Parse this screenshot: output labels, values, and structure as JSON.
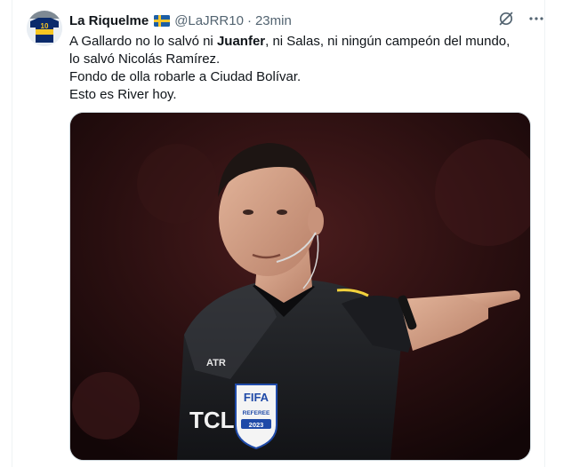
{
  "tweet": {
    "display_name": "La Riquelme",
    "handle": "@LaJRR10",
    "separator": "·",
    "time": "23min",
    "text_line1_before": "A Gallardo no lo salvó ni ",
    "text_line1_bold": "Juanfer",
    "text_line1_after": ", ni Salas, ni ningún campeón del mundo,",
    "text_line2": "lo salvó Nicolás Ramírez.",
    "text_line3": "Fondo de olla robarle a Ciudad Bolívar.",
    "text_line4": "Esto es River hoy."
  },
  "media": {
    "badge_brand": "FIFA",
    "badge_role": "REFEREE",
    "badge_year": "2023",
    "sponsor": "TCL",
    "kit_logo": "ATR"
  },
  "icons": {
    "avatar": "boca-jersey-10-avatar",
    "flag": "sweden-flag-icon",
    "grok": "grok-icon",
    "more": "more-icon"
  },
  "colors": {
    "text": "#0f1419",
    "secondary": "#536471",
    "border": "#cfd9de"
  }
}
